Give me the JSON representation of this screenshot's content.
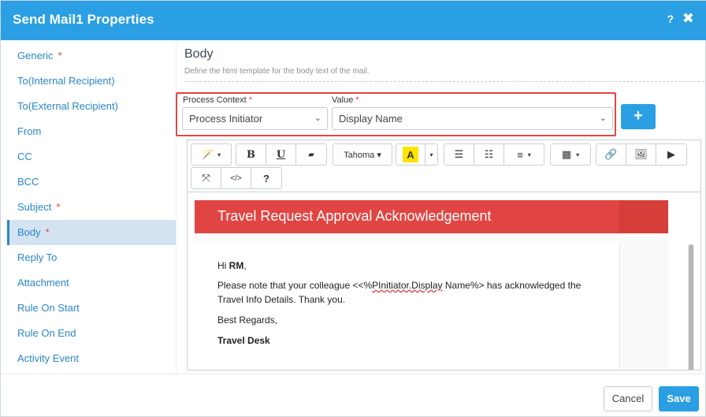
{
  "window": {
    "title": "Send Mail1 Properties",
    "help": "?",
    "close": "✖"
  },
  "sidebar": {
    "items": [
      {
        "label": "Generic",
        "required": "*"
      },
      {
        "label": "To(Internal Recipient)"
      },
      {
        "label": "To(External Recipient)"
      },
      {
        "label": "From"
      },
      {
        "label": "CC"
      },
      {
        "label": "BCC"
      },
      {
        "label": "Subject",
        "required": "*"
      },
      {
        "label": "Body",
        "required": "*",
        "active": true
      },
      {
        "label": "Reply To"
      },
      {
        "label": "Attachment"
      },
      {
        "label": "Rule On Start"
      },
      {
        "label": "Rule On End"
      },
      {
        "label": "Activity Event"
      }
    ]
  },
  "main": {
    "title": "Body",
    "description": "Define the html template for the body text of the mail.",
    "process_context": {
      "label": "Process Context",
      "required": "*",
      "value": "Process Initiator"
    },
    "value_field": {
      "label": "Value",
      "required": "*",
      "value": "Display Name"
    },
    "add_label": "+"
  },
  "toolbar": {
    "wand": "🪄",
    "chev": "▾",
    "bold": "B",
    "underline": "U",
    "eraser": "▰",
    "font": "Tahoma ▾",
    "highlight": "A",
    "ul": "☰",
    "ol": "☷",
    "align": "≡",
    "table": "▦",
    "link": "🔗",
    "image": "🖼",
    "video": "▶",
    "fullscreen": "⤧",
    "code": "</>",
    "help": "?"
  },
  "email": {
    "banner": "Travel Request Approval Acknowledgement",
    "greeting_prefix": "Hi ",
    "greeting_name": "RM",
    "greeting_suffix": ",",
    "line1_a": "Please note that your colleague <<%",
    "line1_b": "PInitiator.Display",
    "line1_c": " Name%>  has acknowledged the",
    "line2": "Travel Info Details. Thank you.",
    "regards": "Best Regards,",
    "signature": "Travel Desk"
  },
  "footer": {
    "cancel": "Cancel",
    "save": "Save"
  },
  "colors": {
    "accent": "#2a9fe3",
    "required": "#e0433d",
    "banner": "#e14543"
  }
}
